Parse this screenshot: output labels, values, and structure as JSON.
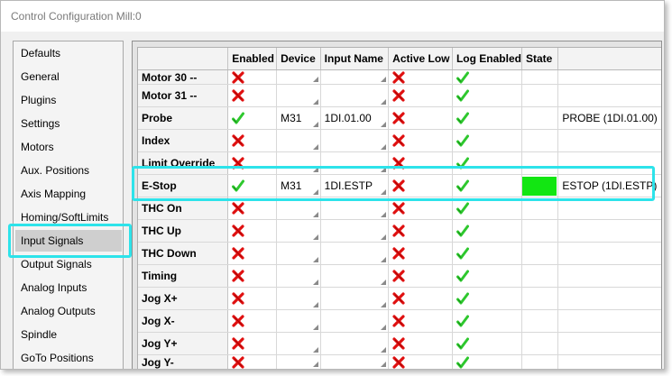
{
  "window": {
    "title": "Control Configuration Mill:0"
  },
  "nav": {
    "items": [
      {
        "label": "Defaults",
        "selected": false
      },
      {
        "label": "General",
        "selected": false
      },
      {
        "label": "Plugins",
        "selected": false
      },
      {
        "label": "Settings",
        "selected": false
      },
      {
        "label": "Motors",
        "selected": false
      },
      {
        "label": "Aux. Positions",
        "selected": false
      },
      {
        "label": "Axis Mapping",
        "selected": false
      },
      {
        "label": "Homing/SoftLimits",
        "selected": false
      },
      {
        "label": "Input Signals",
        "selected": true
      },
      {
        "label": "Output Signals",
        "selected": false
      },
      {
        "label": "Analog Inputs",
        "selected": false
      },
      {
        "label": "Analog Outputs",
        "selected": false
      },
      {
        "label": "Spindle",
        "selected": false
      },
      {
        "label": "GoTo Positions",
        "selected": false
      }
    ]
  },
  "grid": {
    "columns": [
      "",
      "Enabled",
      "Device",
      "Input Name",
      "Active Low",
      "Log Enabled",
      "State",
      ""
    ],
    "rows": [
      {
        "name": "Motor 30 --",
        "enabled": "x",
        "device": "",
        "input_name": "",
        "active_low": "x",
        "log_enabled": "check",
        "state": "",
        "state_color": "",
        "display": ""
      },
      {
        "name": "Motor 31 --",
        "enabled": "x",
        "device": "",
        "input_name": "",
        "active_low": "x",
        "log_enabled": "check",
        "state": "",
        "state_color": "",
        "display": ""
      },
      {
        "name": "Probe",
        "enabled": "check",
        "device": "M31",
        "input_name": "1DI.01.00",
        "active_low": "x",
        "log_enabled": "check",
        "state": "",
        "state_color": "",
        "display": "PROBE (1DI.01.00)"
      },
      {
        "name": "Index",
        "enabled": "x",
        "device": "",
        "input_name": "",
        "active_low": "x",
        "log_enabled": "check",
        "state": "",
        "state_color": "",
        "display": ""
      },
      {
        "name": "Limit Override",
        "enabled": "x",
        "device": "",
        "input_name": "",
        "active_low": "x",
        "log_enabled": "check",
        "state": "",
        "state_color": "",
        "display": ""
      },
      {
        "name": "E-Stop",
        "enabled": "check",
        "device": "M31",
        "input_name": "1DI.ESTP",
        "active_low": "x",
        "log_enabled": "check",
        "state": "on",
        "state_color": "#12e612",
        "display": "ESTOP (1DI.ESTP)"
      },
      {
        "name": "THC On",
        "enabled": "x",
        "device": "",
        "input_name": "",
        "active_low": "x",
        "log_enabled": "check",
        "state": "",
        "state_color": "",
        "display": ""
      },
      {
        "name": "THC Up",
        "enabled": "x",
        "device": "",
        "input_name": "",
        "active_low": "x",
        "log_enabled": "check",
        "state": "",
        "state_color": "",
        "display": ""
      },
      {
        "name": "THC Down",
        "enabled": "x",
        "device": "",
        "input_name": "",
        "active_low": "x",
        "log_enabled": "check",
        "state": "",
        "state_color": "",
        "display": ""
      },
      {
        "name": "Timing",
        "enabled": "x",
        "device": "",
        "input_name": "",
        "active_low": "x",
        "log_enabled": "check",
        "state": "",
        "state_color": "",
        "display": ""
      },
      {
        "name": "Jog X+",
        "enabled": "x",
        "device": "",
        "input_name": "",
        "active_low": "x",
        "log_enabled": "check",
        "state": "",
        "state_color": "",
        "display": ""
      },
      {
        "name": "Jog X-",
        "enabled": "x",
        "device": "",
        "input_name": "",
        "active_low": "x",
        "log_enabled": "check",
        "state": "",
        "state_color": "",
        "display": ""
      },
      {
        "name": "Jog Y+",
        "enabled": "x",
        "device": "",
        "input_name": "",
        "active_low": "x",
        "log_enabled": "check",
        "state": "",
        "state_color": "",
        "display": ""
      },
      {
        "name": "Jog Y-",
        "enabled": "x",
        "device": "",
        "input_name": "",
        "active_low": "x",
        "log_enabled": "check",
        "state": "",
        "state_color": "",
        "display": ""
      }
    ]
  },
  "icons": {
    "x": "red-x-icon",
    "check": "green-check-icon"
  },
  "colors": {
    "highlight": "#2de3ea",
    "x_mark": "#e01010",
    "check_mark": "#2ec82e"
  }
}
